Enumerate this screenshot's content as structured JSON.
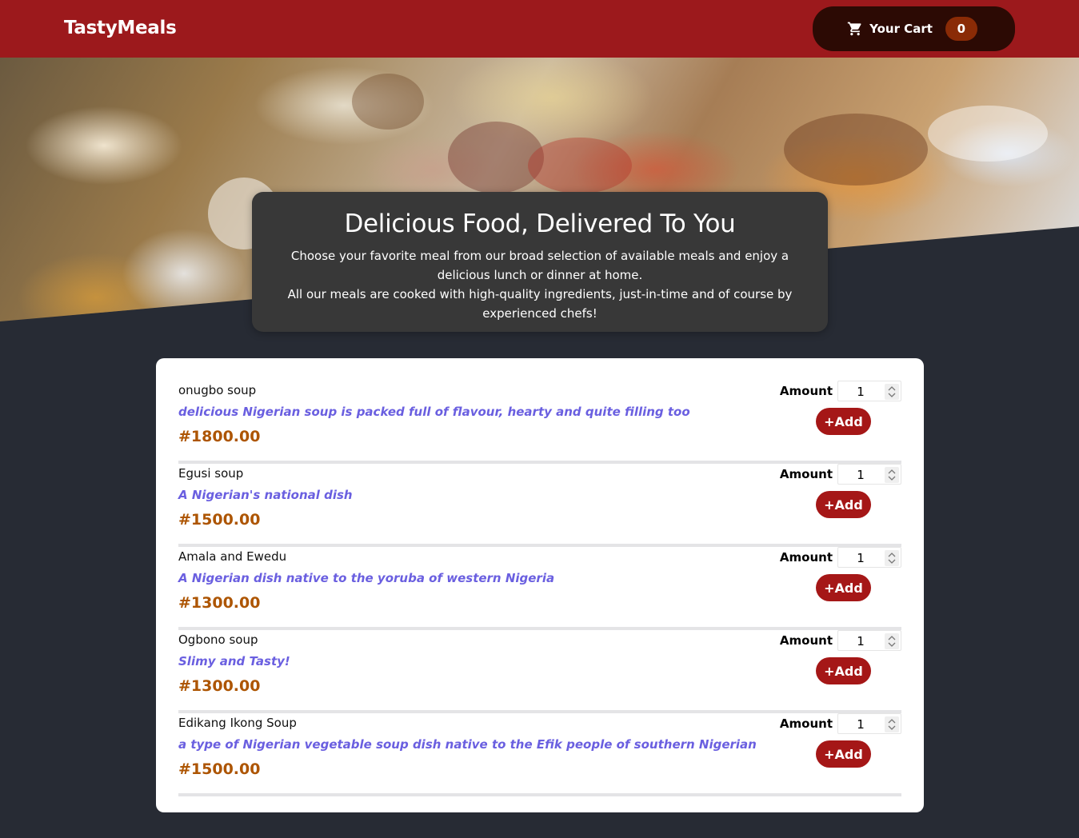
{
  "header": {
    "brand": "TastyMeals",
    "cart_label": "Your Cart",
    "cart_count": "0",
    "cart_icon": "cart-icon"
  },
  "summary": {
    "title": "Delicious Food, Delivered To You",
    "line1": "Choose your favorite meal from our broad selection of available meals and enjoy a delicious lunch or dinner at home.",
    "line2": "All our meals are cooked with high-quality ingredients, just-in-time and of course by experienced chefs!"
  },
  "meals": [
    {
      "name": "onugbo soup",
      "description": "delicious Nigerian soup is packed full of flavour, hearty and quite filling too",
      "price": "#1800.00",
      "amount_label": "Amount",
      "amount": "1",
      "add_label": "+Add"
    },
    {
      "name": "Egusi soup",
      "description": "A Nigerian's national dish",
      "price": "#1500.00",
      "amount_label": "Amount",
      "amount": "1",
      "add_label": "+Add"
    },
    {
      "name": "Amala and Ewedu",
      "description": "A Nigerian dish native to the yoruba of western Nigeria",
      "price": "#1300.00",
      "amount_label": "Amount",
      "amount": "1",
      "add_label": "+Add"
    },
    {
      "name": "Ogbono soup",
      "description": "Slimy and Tasty!",
      "price": "#1300.00",
      "amount_label": "Amount",
      "amount": "1",
      "add_label": "+Add"
    },
    {
      "name": "Edikang Ikong Soup",
      "description": "a type of Nigerian vegetable soup dish native to the Efik people of southern Nigerian",
      "price": "#1500.00",
      "amount_label": "Amount",
      "amount": "1",
      "add_label": "+Add"
    }
  ],
  "colors": {
    "header_bg": "#9c191c",
    "cart_button_bg": "#2c0a04",
    "badge_bg": "#8a2b06",
    "page_bg": "#272b34",
    "description": "#6a5fe0",
    "price": "#ad5502",
    "add_button": "#a51717"
  }
}
